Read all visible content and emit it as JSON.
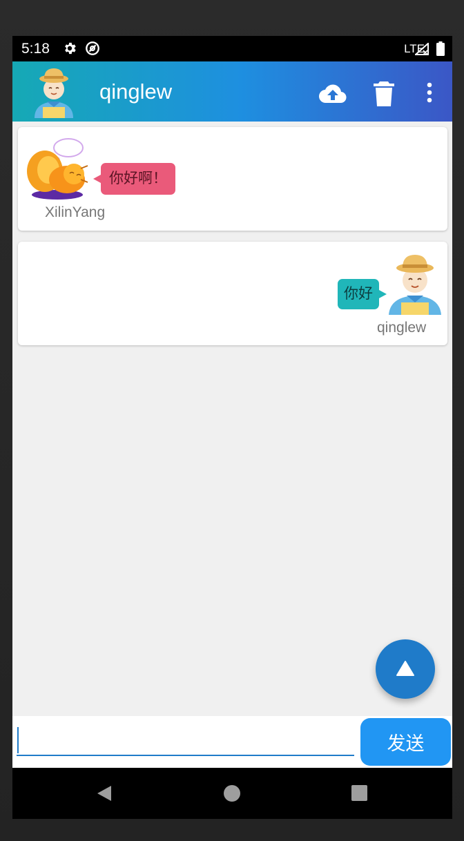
{
  "status_bar": {
    "time": "5:18",
    "network": "LTE",
    "icons": [
      "gear-icon",
      "sync-icon",
      "signal-icon",
      "battery-icon"
    ]
  },
  "app_bar": {
    "title": "qinglew",
    "actions": [
      "upload-cloud-icon",
      "trash-icon",
      "more-vertical-icon"
    ]
  },
  "messages": [
    {
      "sender": "XilinYang",
      "text": "你好啊！",
      "side": "left",
      "bubble_color": "#ea5a7a",
      "avatar": "squirrel-avatar"
    },
    {
      "sender": "qinglew",
      "text": "你好",
      "side": "right",
      "bubble_color": "#20b6b9",
      "avatar": "farmer-avatar"
    }
  ],
  "input": {
    "value": "",
    "placeholder": "",
    "send_label": "发送"
  },
  "fab": {
    "icon": "triangle-up-icon"
  },
  "nav_bar": {
    "icons": [
      "back-icon",
      "home-icon",
      "recents-icon"
    ]
  },
  "colors": {
    "app_bar_gradient": [
      "#16a9b5",
      "#1e8fe0",
      "#3b57c6"
    ],
    "accent": "#2196f3",
    "fab": "#1f7bc9",
    "background": "#f0f0f0"
  }
}
